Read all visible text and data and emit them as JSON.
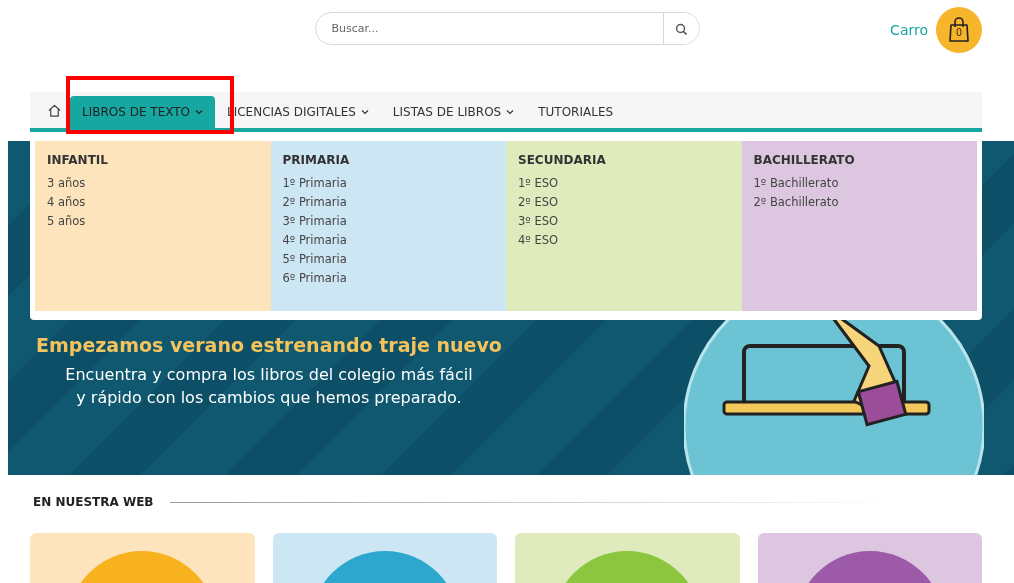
{
  "header": {
    "search": {
      "placeholder": "Buscar..."
    },
    "cart": {
      "label": "Carro",
      "count": "0"
    }
  },
  "nav": {
    "items": [
      {
        "kind": "home",
        "selected": false
      },
      {
        "kind": "menu",
        "label": "LIBROS DE TEXTO",
        "dropdown": true,
        "selected": true
      },
      {
        "kind": "menu",
        "label": "LICENCIAS DIGITALES",
        "dropdown": true,
        "selected": false
      },
      {
        "kind": "menu",
        "label": "LISTAS DE LIBROS",
        "dropdown": true,
        "selected": false
      },
      {
        "kind": "menu",
        "label": "TUTORIALES",
        "dropdown": false,
        "selected": false
      }
    ]
  },
  "mega_menu": {
    "columns": [
      {
        "title": "INFANTIL",
        "color": "#fde4bc",
        "links": [
          "3 años",
          "4 años",
          "5 años"
        ]
      },
      {
        "title": "PRIMARIA",
        "color": "#cde6f4",
        "links": [
          "1º Primaria",
          "2º Primaria",
          "3º Primaria",
          "4º Primaria",
          "5º Primaria",
          "6º Primaria"
        ]
      },
      {
        "title": "SECUNDARIA",
        "color": "#e0ebbd",
        "links": [
          "1º ESO",
          "2º ESO",
          "3º ESO",
          "4º ESO"
        ]
      },
      {
        "title": "BACHILLERATO",
        "color": "#dcc6e0",
        "links": [
          "1º Bachillerato",
          "2º Bachillerato"
        ]
      }
    ]
  },
  "banner": {
    "headline": "Empezamos verano estrenando traje nuevo",
    "text_lines": [
      "Encuentra y compra los libros del colegio más fácil",
      "y rápido con los cambios que hemos preparado."
    ]
  },
  "section": {
    "title": "EN NUESTRA WEB",
    "cards": [
      {
        "color": "#fde4bc",
        "circle": {
          "color": "#f7b21e"
        }
      },
      {
        "color": "#cde6f4",
        "circle": {
          "color": "#2ea7cf"
        }
      },
      {
        "color": "#e0ebbd",
        "circle": {
          "color": "#8cc63e"
        }
      },
      {
        "color": "#dcc6e0",
        "circle": {
          "color": "#9c5aa8"
        }
      }
    ]
  }
}
